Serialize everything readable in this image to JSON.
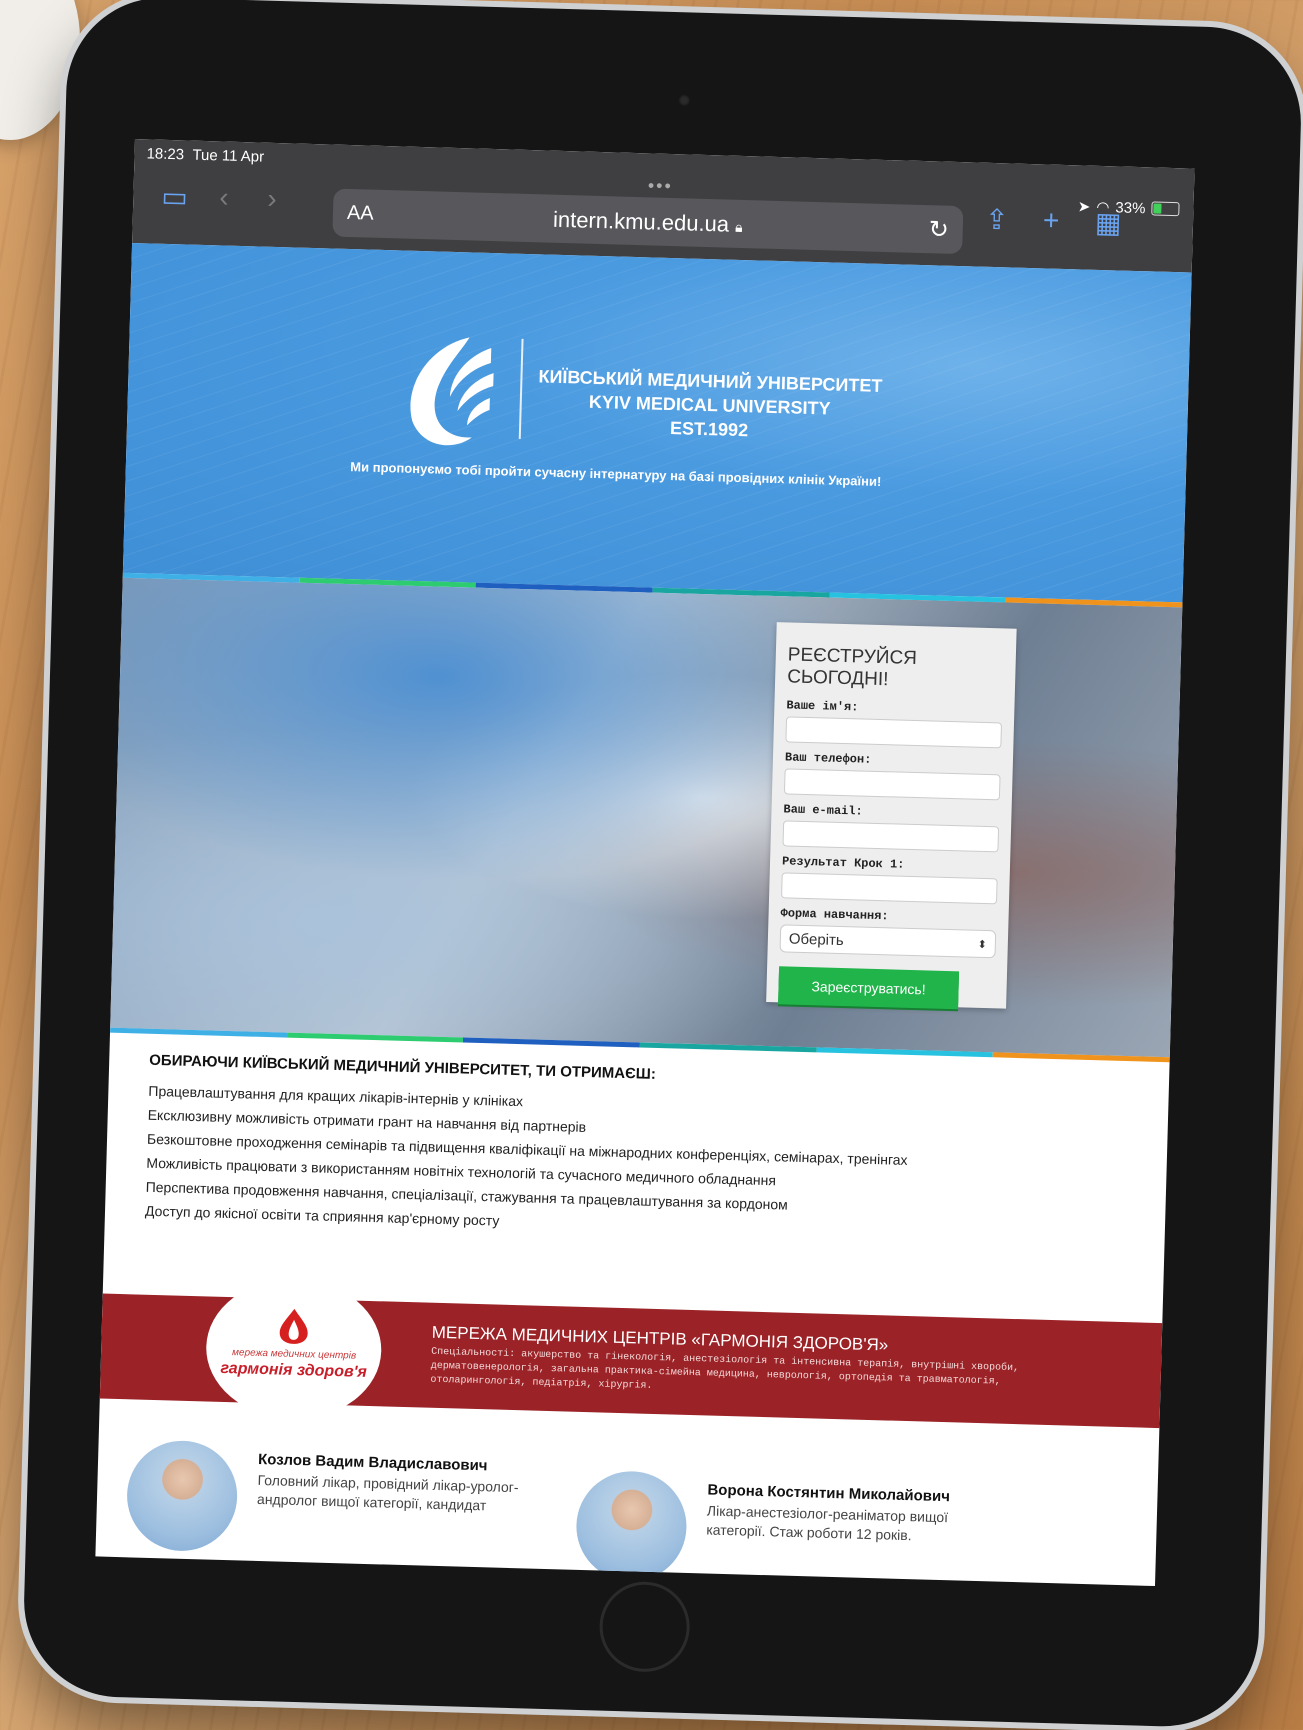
{
  "status": {
    "time": "18:23",
    "date": "Tue 11 Apr",
    "battery": "33%"
  },
  "browser": {
    "text_size": "AA",
    "url": "intern.kmu.edu.ua"
  },
  "hero": {
    "brand_ua": "КИЇВСЬКИЙ МЕДИЧНИЙ УНІВЕРСИТЕТ",
    "brand_en": "KYIV MEDICAL UNIVERSITY",
    "est": "EST.1992",
    "tagline": "Ми пропонуємо тобі пройти сучасну інтернатуру на базі провідних клінік України!"
  },
  "stripe_colors": [
    "#3fb0e6",
    "#2ecc71",
    "#1f5fbf",
    "#1aa6a0",
    "#27c2e0",
    "#f0931c"
  ],
  "form": {
    "title": "РЕЄСТРУЙСЯ СЬОГОДНІ!",
    "name_label": "Ваше ім'я:",
    "phone_label": "Ваш телефон:",
    "email_label": "Ваш e-mail:",
    "krok_label": "Результат Крок 1:",
    "study_label": "Форма навчання:",
    "study_value": "Оберіть",
    "submit": "Зареєструватись!"
  },
  "benefits": {
    "title": "ОБИРАЮЧИ КИЇВСЬКИЙ МЕДИЧНИЙ УНІВЕРСИТЕТ, ТИ ОТРИМАЄШ:",
    "items": [
      "Працевлаштування для кращих лікарів-інтернів у клініках",
      "Ексклюзивну можливість отримати грант на навчання від партнерів",
      "Безкоштовне проходження семінарів та підвищення кваліфікації на міжнародних конференціях, семінарах, тренінгах",
      "Можливість працювати з використанням новітніх технологій та сучасного медичного обладнання",
      "Перспектива продовження навчання, спеціалізації, стажування та працевлаштування за кордоном",
      "Доступ до якісної освіти та сприяння кар'єрному росту"
    ]
  },
  "partner": {
    "logo_sub": "мережа медичних центрів",
    "logo_name": "гармонія здоров'я",
    "title": "МЕРЕЖА МЕДИЧНИХ ЦЕНТРІВ «ГАРМОНІЯ ЗДОРОВ'Я»",
    "specialties": "Спеціальності: акушерство та гінекологія, анестезіологія та інтенсивна терапія, внутрішні хвороби, дерматовенерологія, загальна практика-сімейна медицина, неврологія, ортопедія та травматологія, отоларингологія, педіатрія, хірургія."
  },
  "doctors": [
    {
      "name": "Козлов Вадим Владиславович",
      "desc": "Головний лікар, провідний лікар-уролог-андролог вищої категорії, кандидат"
    },
    {
      "name": "Ворона Костянтин Миколайович",
      "desc": "Лікар-анестезіолог-реаніматор вищої категорії. Стаж роботи 12 років."
    }
  ]
}
